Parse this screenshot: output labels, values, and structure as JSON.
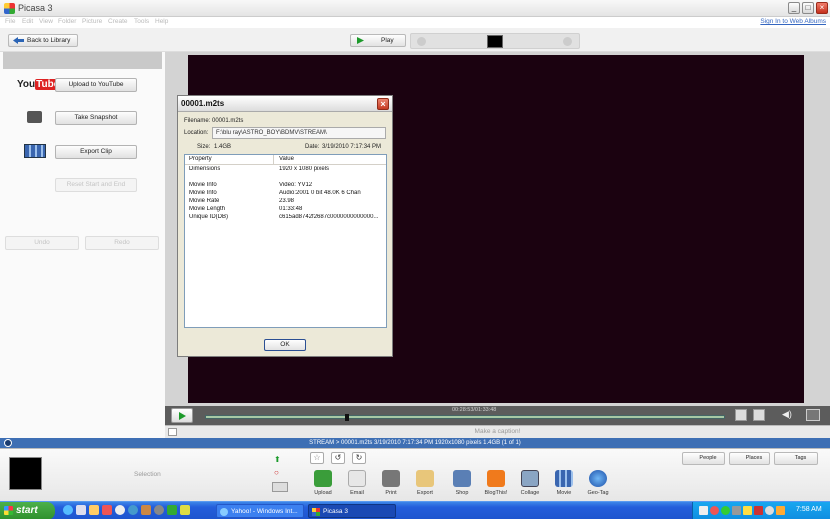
{
  "window": {
    "title": "Picasa 3"
  },
  "menu": [
    "File",
    "Edit",
    "View",
    "Folder",
    "Picture",
    "Create",
    "Tools",
    "Help"
  ],
  "signin": "Sign In to Web Albums",
  "toolbar": {
    "back": "Back to Library",
    "play": "Play"
  },
  "left_panel": {
    "youtube_logo": "YouTube",
    "upload": "Upload to YouTube",
    "snapshot": "Take Snapshot",
    "export": "Export Clip",
    "reset": "Reset Start and End",
    "undo": "Undo",
    "redo": "Redo"
  },
  "scrubber": {
    "time": "00:28:53/01:33:48"
  },
  "caption_placeholder": "Make a caption!",
  "status": "STREAM > 00001.m2ts   3/19/2010 7:17:34 PM   1920x1080 pixels   1.4GB   (1 of 1)",
  "dialog": {
    "title": "00001.m2ts",
    "filename_label": "Filename:",
    "filename": "00001.m2ts",
    "location_label": "Location:",
    "location": "F:\\blu ray\\ASTRO_BOY\\BDMV\\STREAM\\",
    "size_label": "Size:",
    "size": "1.4GB",
    "date_label": "Date:",
    "date": "3/19/2010 7:17:34 PM",
    "columns": [
      "Property",
      "Value"
    ],
    "rows": [
      {
        "property": "Dimensions",
        "value": "1920 x 1080 pixels"
      },
      {
        "property": "Movie Info",
        "value": "Video: YV12"
      },
      {
        "property": "Movie Info",
        "value": "Audio:2001 0 bit 48.0K 6 Chan"
      },
      {
        "property": "Movie Rate",
        "value": "23.98"
      },
      {
        "property": "Movie Length",
        "value": "01:33:48"
      },
      {
        "property": "Unique ID(DB)",
        "value": "c615ad8742f2687c0000000000000..."
      }
    ],
    "ok": "OK"
  },
  "tray": {
    "selection": "Selection",
    "people": "People",
    "places": "Places",
    "tags": "Tags",
    "tools": [
      "Upload",
      "Email",
      "Print",
      "Export",
      "Shop",
      "BlogThis!",
      "Collage",
      "Movie",
      "Geo-Tag"
    ]
  },
  "taskbar": {
    "start": "start",
    "tasks": [
      "Yahoo! - Windows Int...",
      "Picasa 3"
    ],
    "clock": "7:58 AM"
  }
}
